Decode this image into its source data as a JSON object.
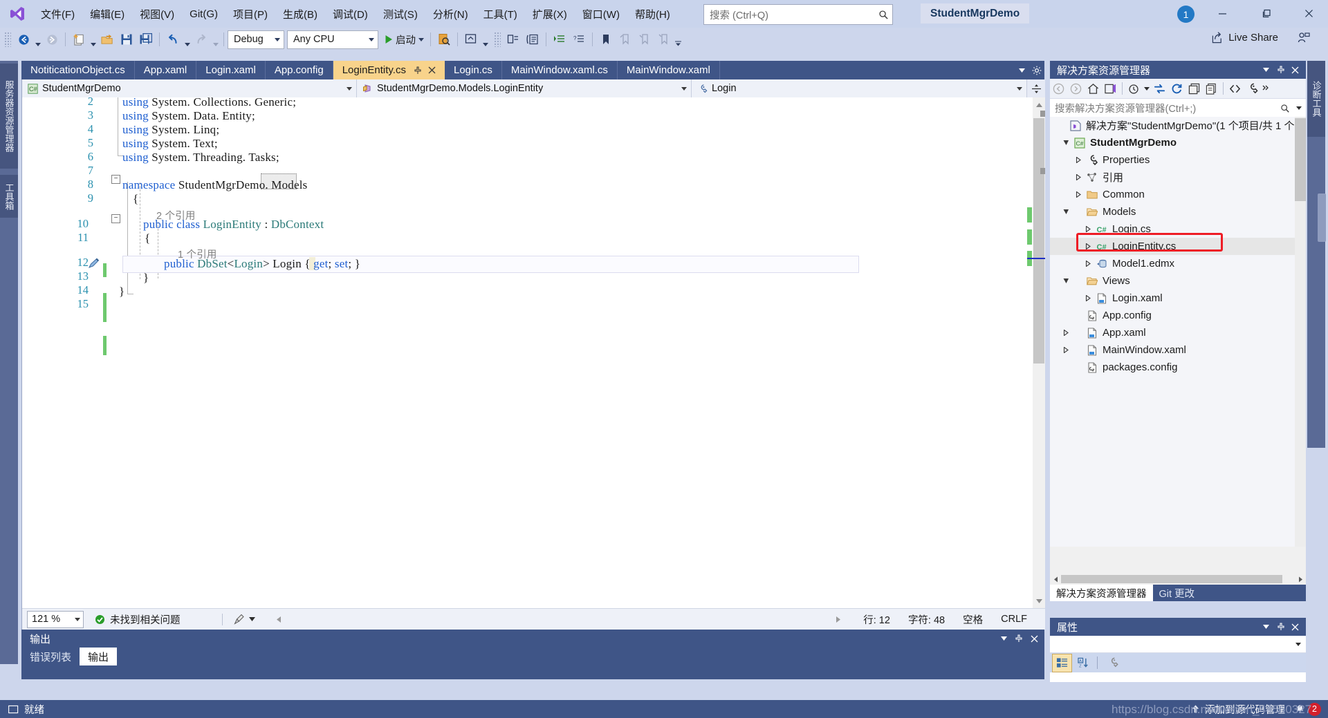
{
  "window": {
    "project_chip": "StudentMgrDemo",
    "notification_count": "1",
    "minimize": "—",
    "maximize": "❐",
    "close": "✕"
  },
  "menu": {
    "items": [
      {
        "label": "文件(F)",
        "name": "menu-file"
      },
      {
        "label": "编辑(E)",
        "name": "menu-edit"
      },
      {
        "label": "视图(V)",
        "name": "menu-view"
      },
      {
        "label": "Git(G)",
        "name": "menu-git"
      },
      {
        "label": "项目(P)",
        "name": "menu-project"
      },
      {
        "label": "生成(B)",
        "name": "menu-build"
      },
      {
        "label": "调试(D)",
        "name": "menu-debug"
      },
      {
        "label": "测试(S)",
        "name": "menu-test"
      },
      {
        "label": "分析(N)",
        "name": "menu-analyze"
      },
      {
        "label": "工具(T)",
        "name": "menu-tools"
      },
      {
        "label": "扩展(X)",
        "name": "menu-extensions"
      },
      {
        "label": "窗口(W)",
        "name": "menu-window"
      },
      {
        "label": "帮助(H)",
        "name": "menu-help"
      }
    ]
  },
  "search": {
    "placeholder": "搜索 (Ctrl+Q)",
    "value": ""
  },
  "toolbar": {
    "config_value": "Debug",
    "platform_value": "Any CPU",
    "start_label": "启动",
    "live_share_label": "Live Share"
  },
  "left_strip": {
    "tabs": [
      {
        "label": "服务器资源管理器",
        "name": "vtab-server-explorer"
      },
      {
        "label": "工具箱",
        "name": "vtab-toolbox"
      }
    ]
  },
  "right_strip": {
    "tabs": [
      {
        "label": "诊断工具",
        "name": "vtab-diagnostic-tools"
      }
    ]
  },
  "document_tabs": [
    {
      "label": "NotiticationObject.cs",
      "active": false
    },
    {
      "label": "App.xaml",
      "active": false
    },
    {
      "label": "Login.xaml",
      "active": false
    },
    {
      "label": "App.config",
      "active": false
    },
    {
      "label": "LoginEntity.cs",
      "active": true
    },
    {
      "label": "Login.cs",
      "active": false
    },
    {
      "label": "MainWindow.xaml.cs",
      "active": false
    },
    {
      "label": "MainWindow.xaml",
      "active": false
    }
  ],
  "nav_bar": {
    "project": "StudentMgrDemo",
    "type": "StudentMgrDemo.Models.LoginEntity",
    "member": "Login"
  },
  "code": {
    "lines": [
      {
        "num": "2",
        "segments": [
          {
            "t": "using",
            "c": "kw"
          },
          {
            "t": " System. Collections. Generic;",
            "c": ""
          }
        ],
        "indent": 0
      },
      {
        "num": "3",
        "segments": [
          {
            "t": "using",
            "c": "kw"
          },
          {
            "t": " System. Data. Entity;",
            "c": ""
          }
        ],
        "indent": 0
      },
      {
        "num": "4",
        "segments": [
          {
            "t": "using",
            "c": "kw"
          },
          {
            "t": " System. Linq;",
            "c": ""
          }
        ],
        "indent": 0
      },
      {
        "num": "5",
        "segments": [
          {
            "t": "using",
            "c": "kw"
          },
          {
            "t": " System. Text;",
            "c": ""
          }
        ],
        "indent": 0
      },
      {
        "num": "6",
        "segments": [
          {
            "t": "using",
            "c": "kw"
          },
          {
            "t": " System. Threading. Tasks;",
            "c": ""
          }
        ],
        "indent": 0
      },
      {
        "num": "7",
        "segments": [],
        "indent": 0
      },
      {
        "num": "8",
        "segments": [
          {
            "t": "namespace",
            "c": "kw"
          },
          {
            "t": " StudentMgrDemo. Models",
            "c": ""
          }
        ],
        "indent": 0
      },
      {
        "num": "9",
        "segments": [
          {
            "t": "{",
            "c": ""
          }
        ],
        "indent": 0
      },
      {
        "num": "10",
        "segments": [
          {
            "t": "public class",
            "c": "kw"
          },
          {
            "t": " ",
            "c": ""
          },
          {
            "t": "LoginEntity",
            "c": "tp"
          },
          {
            "t": " : ",
            "c": ""
          },
          {
            "t": "DbContext",
            "c": "tp"
          }
        ],
        "indent": 0
      },
      {
        "num": "11",
        "segments": [
          {
            "t": "{",
            "c": ""
          }
        ],
        "indent": 0
      },
      {
        "num": "12",
        "segments": [
          {
            "t": "public",
            "c": "kw"
          },
          {
            "t": " ",
            "c": ""
          },
          {
            "t": "DbSet",
            "c": "tp"
          },
          {
            "t": "<",
            "c": ""
          },
          {
            "t": "Login",
            "c": "tp"
          },
          {
            "t": "> Login { ",
            "c": ""
          },
          {
            "t": "get",
            "c": "kw"
          },
          {
            "t": "; ",
            "c": ""
          },
          {
            "t": "set",
            "c": "kw"
          },
          {
            "t": "; }",
            "c": ""
          }
        ],
        "indent": 0
      },
      {
        "num": "13",
        "segments": [
          {
            "t": "}",
            "c": ""
          }
        ],
        "indent": 0
      },
      {
        "num": "14",
        "segments": [
          {
            "t": "}",
            "c": ""
          }
        ],
        "indent": 0
      },
      {
        "num": "15",
        "segments": [],
        "indent": 0
      }
    ],
    "codelens_class": "2 个引用",
    "codelens_member": "1 个引用"
  },
  "editor_status": {
    "zoom": "121 %",
    "issues": "未找到相关问题",
    "line_label": "行: 12",
    "char_label": "字符: 48",
    "indent": "空格",
    "eol": "CRLF"
  },
  "output_panel": {
    "title": "输出",
    "tabs": [
      {
        "label": "错误列表",
        "active": false
      },
      {
        "label": "输出",
        "active": true
      }
    ]
  },
  "solution_explorer": {
    "title": "解决方案资源管理器",
    "search_placeholder": "搜索解决方案资源管理器(Ctrl+;)",
    "tree": [
      {
        "label": "解决方案\"StudentMgrDemo\"(1 个项目/共 1 个",
        "indent": 0,
        "icon": "solution",
        "expander": "none",
        "bold": false,
        "selected": false
      },
      {
        "label": "StudentMgrDemo",
        "indent": 1,
        "icon": "csproj",
        "expander": "open",
        "bold": true,
        "selected": false
      },
      {
        "label": "Properties",
        "indent": 2,
        "icon": "wrench",
        "expander": "closed",
        "bold": false,
        "selected": false
      },
      {
        "label": "引用",
        "indent": 2,
        "icon": "refs",
        "expander": "closed",
        "bold": false,
        "selected": false
      },
      {
        "label": "Common",
        "indent": 2,
        "icon": "folder",
        "expander": "closed",
        "bold": false,
        "selected": false
      },
      {
        "label": "Models",
        "indent": 2,
        "icon": "folder-open",
        "expander": "open",
        "bold": false,
        "selected": false
      },
      {
        "label": "Login.cs",
        "indent": 3,
        "icon": "cs",
        "expander": "closed",
        "bold": false,
        "selected": false
      },
      {
        "label": "LoginEntity.cs",
        "indent": 3,
        "icon": "cs",
        "expander": "closed",
        "bold": false,
        "selected": true
      },
      {
        "label": "Model1.edmx",
        "indent": 3,
        "icon": "edmx",
        "expander": "closed",
        "bold": false,
        "selected": false
      },
      {
        "label": "Views",
        "indent": 2,
        "icon": "folder-open",
        "expander": "open",
        "bold": false,
        "selected": false
      },
      {
        "label": "Login.xaml",
        "indent": 3,
        "icon": "xaml",
        "expander": "closed",
        "bold": false,
        "selected": false
      },
      {
        "label": "App.config",
        "indent": 2,
        "icon": "config",
        "expander": "none",
        "bold": false,
        "selected": false
      },
      {
        "label": "App.xaml",
        "indent": 2,
        "icon": "xaml",
        "expander": "closed",
        "bold": false,
        "selected": false
      },
      {
        "label": "MainWindow.xaml",
        "indent": 2,
        "icon": "xaml",
        "expander": "closed",
        "bold": false,
        "selected": false
      },
      {
        "label": "packages.config",
        "indent": 2,
        "icon": "config",
        "expander": "none",
        "bold": false,
        "selected": false
      }
    ],
    "bottom_tabs": [
      {
        "label": "解决方案资源管理器",
        "active": true
      },
      {
        "label": "Git 更改",
        "active": false
      }
    ]
  },
  "properties_panel": {
    "title": "属性",
    "combo_value": ""
  },
  "status_bar": {
    "ready": "就绪",
    "source_control": "添加到源代码管理",
    "changes_count": "2",
    "watermark": "https://blog.csdn.net/weixin_44560327"
  },
  "colors": {
    "accent": "#3f5587",
    "titlebar": "#c9d4ec",
    "active_tab": "#f8d38b",
    "selection_ring": "#ee1c25",
    "keyword": "#1f5fd0",
    "type": "#2b7a78",
    "linenum": "#2b91af"
  }
}
